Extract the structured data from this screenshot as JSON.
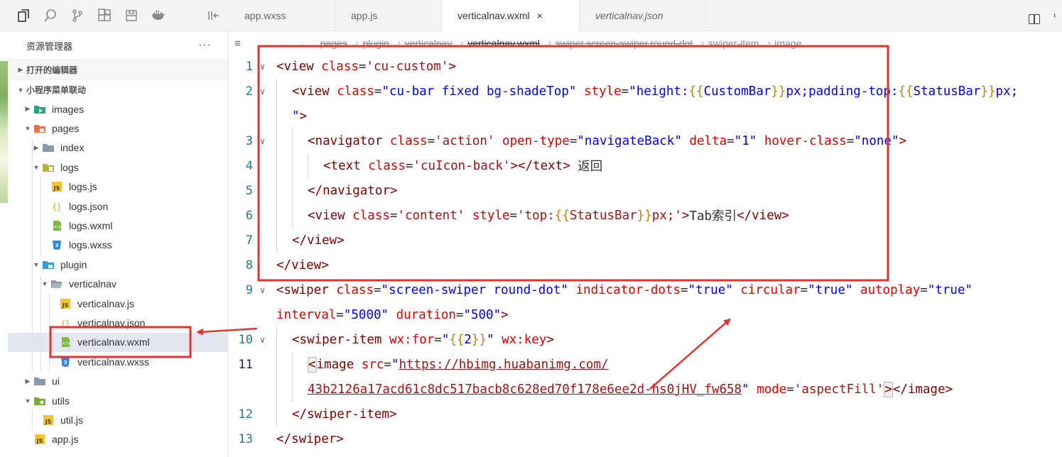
{
  "activity_bar": {
    "icons": [
      "explorer-icon",
      "search-icon",
      "source-control-icon",
      "extensions-icon",
      "storage-icon",
      "docker-icon",
      "collapse-panel-icon"
    ]
  },
  "sidebar": {
    "title": "资源管理器",
    "more": "···",
    "open_editors_label": "打开的编辑器",
    "project_label": "小程序菜单联动",
    "tree": [
      {
        "label": "images",
        "type": "folder-images",
        "depth": 1,
        "caret": "▸"
      },
      {
        "label": "pages",
        "type": "folder-pages",
        "depth": 1,
        "caret": "▾"
      },
      {
        "label": "index",
        "type": "folder",
        "depth": 2,
        "caret": "▸"
      },
      {
        "label": "logs",
        "type": "folder-logs",
        "depth": 2,
        "caret": "▾"
      },
      {
        "label": "logs.js",
        "type": "js",
        "depth": 3,
        "caret": ""
      },
      {
        "label": "logs.json",
        "type": "json",
        "depth": 3,
        "caret": ""
      },
      {
        "label": "logs.wxml",
        "type": "wxml",
        "depth": 3,
        "caret": ""
      },
      {
        "label": "logs.wxss",
        "type": "wxss",
        "depth": 3,
        "caret": ""
      },
      {
        "label": "plugin",
        "type": "folder-plugin",
        "depth": 2,
        "caret": "▾"
      },
      {
        "label": "verticalnav",
        "type": "folder-open",
        "depth": 3,
        "caret": "▾"
      },
      {
        "label": "verticalnav.js",
        "type": "js",
        "depth": 4,
        "caret": ""
      },
      {
        "label": "verticalnav.json",
        "type": "json",
        "depth": 4,
        "caret": ""
      },
      {
        "label": "verticalnav.wxml",
        "type": "wxml",
        "depth": 4,
        "caret": "",
        "selected": true
      },
      {
        "label": "verticalnav.wxss",
        "type": "wxss",
        "depth": 4,
        "caret": ""
      },
      {
        "label": "ui",
        "type": "folder",
        "depth": 1,
        "caret": "▸"
      },
      {
        "label": "utils",
        "type": "folder-utils",
        "depth": 1,
        "caret": "▾"
      },
      {
        "label": "util.js",
        "type": "js",
        "depth": 2,
        "caret": ""
      },
      {
        "label": "app.js",
        "type": "js",
        "depth": 1,
        "caret": ""
      }
    ]
  },
  "tabs": [
    {
      "label": "app.wxss",
      "type": "wxss",
      "active": false,
      "italic": false
    },
    {
      "label": "app.js",
      "type": "js",
      "active": false,
      "italic": false
    },
    {
      "label": "verticalnav.wxml",
      "type": "wxml",
      "active": true,
      "italic": false,
      "close": "×"
    },
    {
      "label": "verticalnav.json",
      "type": "json",
      "active": false,
      "italic": true
    }
  ],
  "breadcrumb": {
    "items": [
      "pages",
      "plugin",
      "verticalnav",
      "verticalnav.wxml",
      "swiper.screen-swiper.round-dot",
      "swiper-item",
      "image"
    ]
  },
  "editor": {
    "lines": [
      {
        "num": "1",
        "indent": 0,
        "fold": true,
        "tokens": [
          [
            "tk-tag",
            "<view"
          ],
          [
            "tk-plain",
            " "
          ],
          [
            "tk-attr",
            "class"
          ],
          [
            "tk-plain",
            "="
          ],
          [
            "tk-str2",
            "'cu-custom'"
          ],
          [
            "tk-tag",
            ">"
          ]
        ]
      },
      {
        "num": "2",
        "indent": 1,
        "fold": true,
        "tokens": [
          [
            "tk-tag",
            "<view"
          ],
          [
            "tk-plain",
            " "
          ],
          [
            "tk-attr",
            "class"
          ],
          [
            "tk-plain",
            "="
          ],
          [
            "tk-str",
            "\"cu-bar fixed bg-shadeTop\""
          ],
          [
            "tk-plain",
            " "
          ],
          [
            "tk-attr",
            "style"
          ],
          [
            "tk-plain",
            "="
          ],
          [
            "tk-str",
            "\"height:"
          ],
          [
            "tk-brace",
            "{{"
          ],
          [
            "tk-str",
            "CustomBar"
          ],
          [
            "tk-brace",
            "}}"
          ],
          [
            "tk-str",
            "px;padding-top:"
          ],
          [
            "tk-brace",
            "{{"
          ],
          [
            "tk-str",
            "StatusBar"
          ],
          [
            "tk-brace",
            "}}"
          ],
          [
            "tk-str",
            "px;"
          ]
        ]
      },
      {
        "num": "",
        "indent": 1,
        "fold": false,
        "tokens": [
          [
            "tk-str",
            "\""
          ],
          [
            "tk-tag",
            ">"
          ]
        ]
      },
      {
        "num": "3",
        "indent": 2,
        "fold": true,
        "tokens": [
          [
            "tk-tag",
            "<navigator"
          ],
          [
            "tk-plain",
            " "
          ],
          [
            "tk-attr",
            "class"
          ],
          [
            "tk-plain",
            "="
          ],
          [
            "tk-str2",
            "'action'"
          ],
          [
            "tk-plain",
            " "
          ],
          [
            "tk-attr",
            "open-type"
          ],
          [
            "tk-plain",
            "="
          ],
          [
            "tk-str",
            "\"navigateBack\""
          ],
          [
            "tk-plain",
            " "
          ],
          [
            "tk-attr",
            "delta"
          ],
          [
            "tk-plain",
            "="
          ],
          [
            "tk-str",
            "\"1\""
          ],
          [
            "tk-plain",
            " "
          ],
          [
            "tk-attr",
            "hover-class"
          ],
          [
            "tk-plain",
            "="
          ],
          [
            "tk-str",
            "\"none\""
          ],
          [
            "tk-tag",
            ">"
          ]
        ]
      },
      {
        "num": "4",
        "indent": 3,
        "fold": false,
        "tokens": [
          [
            "tk-tag",
            "<text"
          ],
          [
            "tk-plain",
            " "
          ],
          [
            "tk-attr",
            "class"
          ],
          [
            "tk-plain",
            "="
          ],
          [
            "tk-str2",
            "'cuIcon-back'"
          ],
          [
            "tk-tag",
            "></text>"
          ],
          [
            "tk-plain",
            " 返回"
          ]
        ]
      },
      {
        "num": "5",
        "indent": 2,
        "fold": false,
        "tokens": [
          [
            "tk-tag",
            "</navigator>"
          ]
        ]
      },
      {
        "num": "6",
        "indent": 2,
        "fold": false,
        "tokens": [
          [
            "tk-tag",
            "<view"
          ],
          [
            "tk-plain",
            " "
          ],
          [
            "tk-attr",
            "class"
          ],
          [
            "tk-plain",
            "="
          ],
          [
            "tk-str2",
            "'content'"
          ],
          [
            "tk-plain",
            " "
          ],
          [
            "tk-attr",
            "style"
          ],
          [
            "tk-plain",
            "="
          ],
          [
            "tk-str2",
            "'top:"
          ],
          [
            "tk-brace",
            "{{"
          ],
          [
            "tk-str2",
            "StatusBar"
          ],
          [
            "tk-brace",
            "}}"
          ],
          [
            "tk-str2",
            "px;'"
          ],
          [
            "tk-tag",
            ">"
          ],
          [
            "tk-plain",
            "Tab索引"
          ],
          [
            "tk-tag",
            "</view>"
          ]
        ]
      },
      {
        "num": "7",
        "indent": 1,
        "fold": false,
        "tokens": [
          [
            "tk-tag",
            "</view>"
          ]
        ]
      },
      {
        "num": "8",
        "indent": 0,
        "fold": false,
        "tokens": [
          [
            "tk-tag",
            "</view>"
          ]
        ]
      },
      {
        "num": "9",
        "indent": 0,
        "fold": true,
        "tokens": [
          [
            "tk-tag",
            "<swiper"
          ],
          [
            "tk-plain",
            " "
          ],
          [
            "tk-attr",
            "class"
          ],
          [
            "tk-plain",
            "="
          ],
          [
            "tk-str",
            "\"screen-swiper round-dot\""
          ],
          [
            "tk-plain",
            " "
          ],
          [
            "tk-attr",
            "indicator-dots"
          ],
          [
            "tk-plain",
            "="
          ],
          [
            "tk-str",
            "\"true\""
          ],
          [
            "tk-plain",
            " "
          ],
          [
            "tk-attr",
            "circular"
          ],
          [
            "tk-plain",
            "="
          ],
          [
            "tk-str",
            "\"true\""
          ],
          [
            "tk-plain",
            " "
          ],
          [
            "tk-attr",
            "autoplay"
          ],
          [
            "tk-plain",
            "="
          ],
          [
            "tk-str",
            "\"true\""
          ]
        ]
      },
      {
        "num": "",
        "indent": 0,
        "fold": false,
        "tokens": [
          [
            "tk-attr",
            "interval"
          ],
          [
            "tk-plain",
            "="
          ],
          [
            "tk-str",
            "\"5000\""
          ],
          [
            "tk-plain",
            " "
          ],
          [
            "tk-attr",
            "duration"
          ],
          [
            "tk-plain",
            "="
          ],
          [
            "tk-str",
            "\"500\""
          ],
          [
            "tk-tag",
            ">"
          ]
        ]
      },
      {
        "num": "10",
        "indent": 1,
        "fold": true,
        "tokens": [
          [
            "tk-tag",
            "<swiper-item"
          ],
          [
            "tk-plain",
            " "
          ],
          [
            "tk-attr",
            "wx:for"
          ],
          [
            "tk-plain",
            "="
          ],
          [
            "tk-str",
            "\""
          ],
          [
            "tk-brace",
            "{{"
          ],
          [
            "tk-str",
            "2"
          ],
          [
            "tk-brace",
            "}}"
          ],
          [
            "tk-str",
            "\""
          ],
          [
            "tk-plain",
            " "
          ],
          [
            "tk-attr",
            "wx:key"
          ],
          [
            "tk-tag",
            ">"
          ]
        ]
      },
      {
        "num": "11",
        "indent": 2,
        "fold": false,
        "current": true,
        "tokens": [
          [
            "tk-tag caret-box",
            "<"
          ],
          [
            "tk-tag",
            "image"
          ],
          [
            "tk-plain",
            " "
          ],
          [
            "tk-attr",
            "src"
          ],
          [
            "tk-plain",
            "="
          ],
          [
            "tk-str",
            "\""
          ],
          [
            "tk-link",
            "https://hbimg.huabanimg.com/"
          ]
        ]
      },
      {
        "num": "",
        "indent": 2,
        "fold": false,
        "tokens": [
          [
            "tk-link",
            "43b2126a17acd61c8dc517bacb8c628ed70f178e6ee2d-hs0jHV_fw658"
          ],
          [
            "tk-str",
            "\""
          ],
          [
            "tk-plain",
            " "
          ],
          [
            "tk-attr",
            "mode"
          ],
          [
            "tk-plain",
            "="
          ],
          [
            "tk-str2",
            "'aspectFill'"
          ],
          [
            "tk-tag caret-box",
            ">"
          ],
          [
            "tk-tag",
            "</image>"
          ]
        ]
      },
      {
        "num": "12",
        "indent": 1,
        "fold": false,
        "tokens": [
          [
            "tk-tag",
            "</swiper-item>"
          ]
        ]
      },
      {
        "num": "13",
        "indent": 0,
        "fold": false,
        "tokens": [
          [
            "tk-tag",
            "</swiper>"
          ]
        ]
      }
    ]
  },
  "annotation": {
    "color": "#e8322d"
  }
}
